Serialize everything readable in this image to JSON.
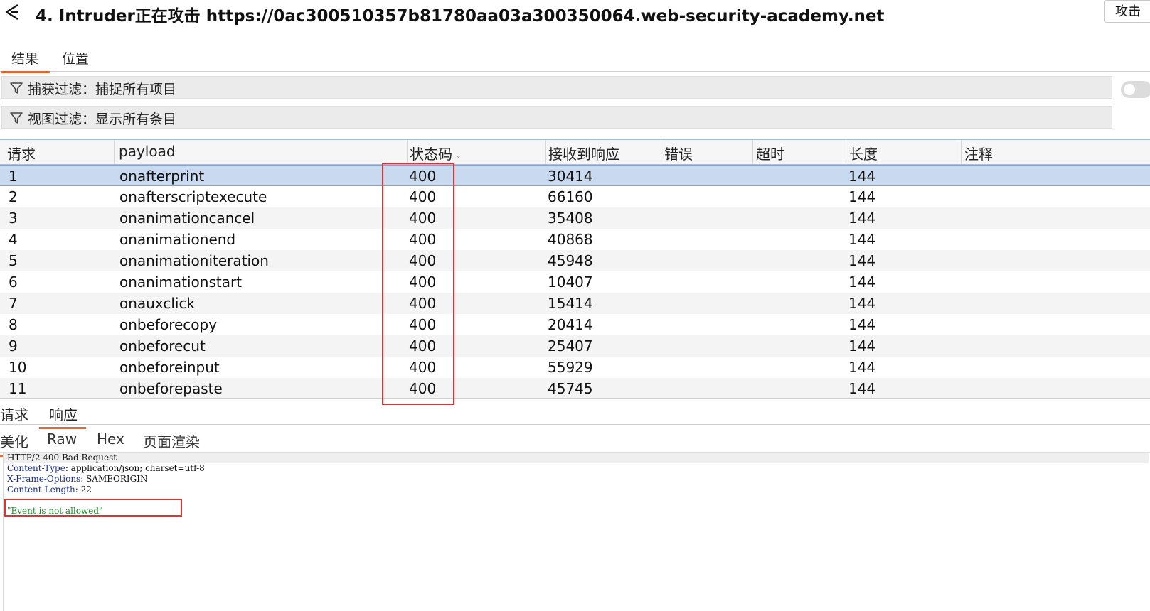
{
  "title": "4. Intruder正在攻击 https://0ac300510357b81780aa03a300350064.web-security-academy.net",
  "attack_button": "攻击",
  "main_tabs": [
    "结果",
    "位置"
  ],
  "capture_filter": "捕获过滤：捕捉所有项目",
  "view_filter": "视图过滤：显示所有条目",
  "table": {
    "columns": [
      "请求",
      "payload",
      "状态码",
      "接收到响应",
      "错误",
      "超时",
      "长度",
      "注释"
    ],
    "rows": [
      {
        "req": "1",
        "payload": "onafterprint",
        "status": "400",
        "received": "30414",
        "length": "144"
      },
      {
        "req": "2",
        "payload": "onafterscriptexecute",
        "status": "400",
        "received": "66160",
        "length": "144"
      },
      {
        "req": "3",
        "payload": "onanimationcancel",
        "status": "400",
        "received": "35408",
        "length": "144"
      },
      {
        "req": "4",
        "payload": "onanimationend",
        "status": "400",
        "received": "40868",
        "length": "144"
      },
      {
        "req": "5",
        "payload": "onanimationiteration",
        "status": "400",
        "received": "45948",
        "length": "144"
      },
      {
        "req": "6",
        "payload": "onanimationstart",
        "status": "400",
        "received": "10407",
        "length": "144"
      },
      {
        "req": "7",
        "payload": "onauxclick",
        "status": "400",
        "received": "15414",
        "length": "144"
      },
      {
        "req": "8",
        "payload": "onbeforecopy",
        "status": "400",
        "received": "20414",
        "length": "144"
      },
      {
        "req": "9",
        "payload": "onbeforecut",
        "status": "400",
        "received": "25407",
        "length": "144"
      },
      {
        "req": "10",
        "payload": "onbeforeinput",
        "status": "400",
        "received": "55929",
        "length": "144"
      },
      {
        "req": "11",
        "payload": "onbeforepaste",
        "status": "400",
        "received": "45745",
        "length": "144"
      }
    ]
  },
  "detail_tabs": [
    "请求",
    "响应"
  ],
  "view_tabs": [
    "美化",
    "Raw",
    "Hex",
    "页面渲染"
  ],
  "response": {
    "status_line": "HTTP/2 400 Bad Request",
    "headers": [
      {
        "name": "Content-Type",
        "value": "application/json; charset=utf-8"
      },
      {
        "name": "X-Frame-Options",
        "value": "SAMEORIGIN"
      },
      {
        "name": "Content-Length",
        "value": "22"
      }
    ],
    "body": "\"Event is not allowed\""
  },
  "colors": {
    "accent": "#e8642c",
    "highlight_box": "#e53030",
    "selected_row": "#c8d9f0",
    "header_name": "#1a2f8c",
    "json_string": "#1e8a2b"
  }
}
